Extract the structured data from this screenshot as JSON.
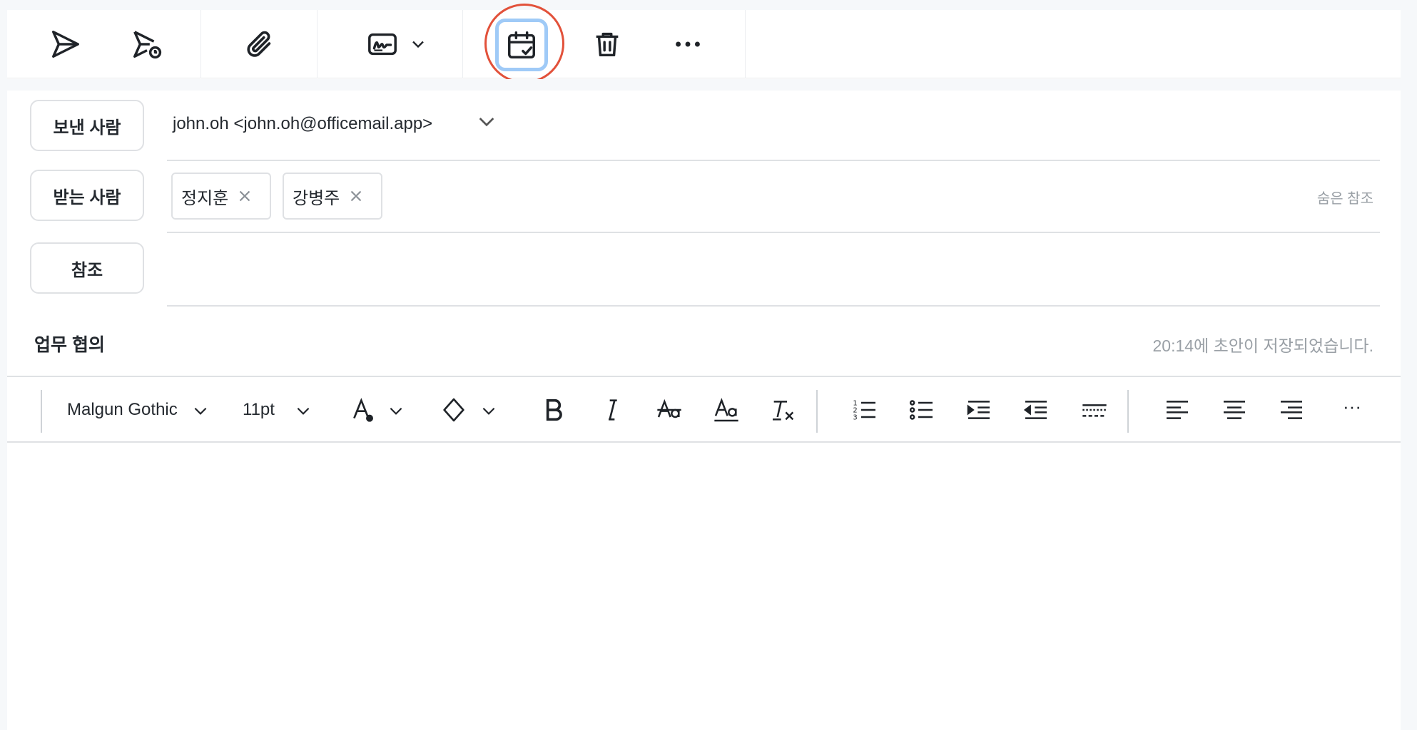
{
  "toolbar": {
    "icons": [
      "send-icon",
      "scheduled-send-icon",
      "attachment-icon",
      "signature-icon",
      "chevron-down-icon",
      "calendar-check-icon",
      "trash-icon",
      "more-horizontal-icon"
    ],
    "highlight_color": "#e2513a",
    "selected_color": "#9fcaf7"
  },
  "header": {
    "from_label": "보낸 사람",
    "from_value": "john.oh <john.oh@officemail.app>",
    "to_label": "받는 사람",
    "recipients": [
      {
        "name": "정지훈"
      },
      {
        "name": "강병주"
      }
    ],
    "bcc_label": "숨은 참조",
    "cc_label": "참조",
    "subject": "업무 협의",
    "saved_status": "20:14에 초안이 저장되었습니다."
  },
  "format_toolbar": {
    "font_family": "Malgun Gothic",
    "font_size": "11pt",
    "more_label": "···"
  }
}
